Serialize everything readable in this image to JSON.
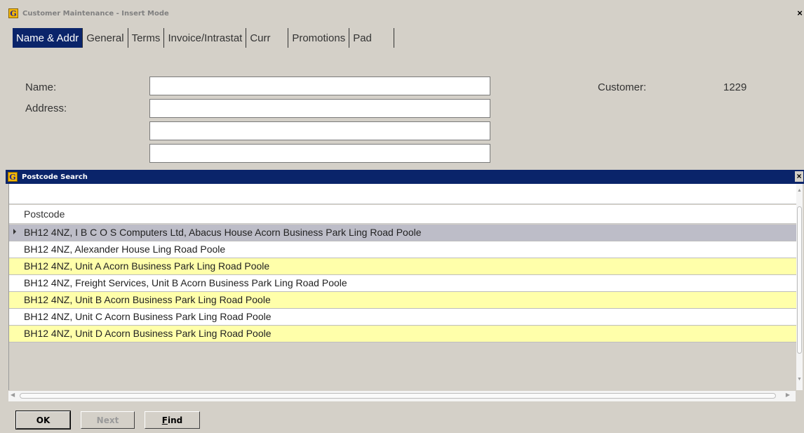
{
  "main_window": {
    "title": "Customer Maintenance - Insert Mode",
    "close_glyph": "×",
    "icon_letter": "G"
  },
  "tabs": [
    {
      "label": "Name & Addr",
      "active": true
    },
    {
      "label": "General",
      "active": false
    },
    {
      "label": "Terms",
      "active": false
    },
    {
      "label": "Invoice/Intrastat",
      "active": false
    },
    {
      "label": "Curr",
      "active": false
    },
    {
      "label": "Promotions",
      "active": false
    },
    {
      "label": "Pad",
      "active": false
    }
  ],
  "form": {
    "name_label": "Name:",
    "address_label": "Address:",
    "name_value": "",
    "address_line1": "",
    "address_line2": "",
    "address_line3": "",
    "customer_label": "Customer:",
    "customer_value": "1229"
  },
  "postcode_dialog": {
    "title": "Postcode Search",
    "close_glyph": "×",
    "icon_letter": "G",
    "column_header": "Postcode",
    "rows": [
      {
        "text": "BH12 4NZ, I B C O S Computers Ltd, Abacus House Acorn Business Park Ling Road Poole",
        "style": "selected"
      },
      {
        "text": "BH12 4NZ, Alexander House Ling Road Poole",
        "style": "plain"
      },
      {
        "text": "BH12 4NZ, Unit A Acorn Business Park Ling Road Poole",
        "style": "alt"
      },
      {
        "text": "BH12 4NZ, Freight Services, Unit B Acorn Business Park Ling Road Poole",
        "style": "plain"
      },
      {
        "text": "BH12 4NZ, Unit B Acorn Business Park Ling Road Poole",
        "style": "alt"
      },
      {
        "text": "BH12 4NZ, Unit C Acorn Business Park Ling Road Poole",
        "style": "plain"
      },
      {
        "text": "BH12 4NZ, Unit D Acorn Business Park Ling Road Poole",
        "style": "alt"
      }
    ],
    "buttons": {
      "ok": "OK",
      "next": "Next",
      "find_underline": "F",
      "find_rest": "ind"
    }
  },
  "colors": {
    "selection_blue": "#0a246a",
    "selected_row": "#bdbdc8",
    "alt_row": "#ffffaa",
    "window_bg": "#d4d0c8"
  }
}
